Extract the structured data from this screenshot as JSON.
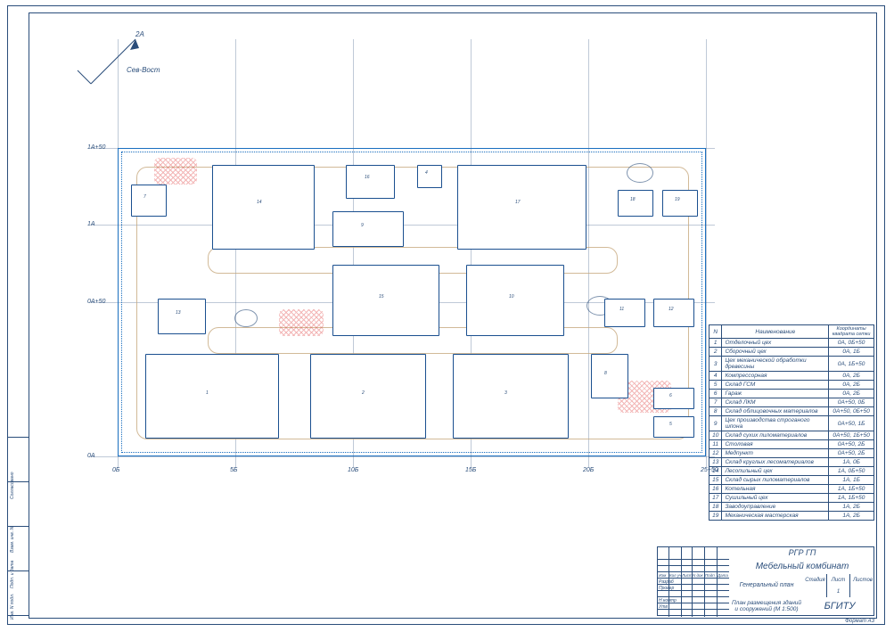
{
  "north": {
    "label": "Сев-Вост",
    "mark": "2А"
  },
  "axes": {
    "vertical": [
      "0Б",
      "5Б",
      "10Б",
      "15Б",
      "20Б",
      "25+50"
    ],
    "horizontal": [
      "1А+50",
      "1А",
      "0А+50",
      "0А"
    ]
  },
  "buildings": [
    {
      "n": 1,
      "name": "Отделочный цех",
      "coord": "0А, 0Б+50"
    },
    {
      "n": 2,
      "name": "Сборочный цех",
      "coord": "0А, 1Б"
    },
    {
      "n": 3,
      "name": "Цех механической обработки древесины",
      "coord": "0А, 1Б+50"
    },
    {
      "n": 4,
      "name": "Компрессорная",
      "coord": "0А, 2Б"
    },
    {
      "n": 5,
      "name": "Склад ГСМ",
      "coord": "0А, 2Б"
    },
    {
      "n": 6,
      "name": "Гараж",
      "coord": "0А, 2Б"
    },
    {
      "n": 7,
      "name": "Склад ЛКМ",
      "coord": "0А+50, 0Б"
    },
    {
      "n": 8,
      "name": "Склад облицовочных материалов",
      "coord": "0А+50, 0Б+50"
    },
    {
      "n": 9,
      "name": "Цех производства строганого шпона",
      "coord": "0А+50, 1Б"
    },
    {
      "n": 10,
      "name": "Склад сухих пиломатериалов",
      "coord": "0А+50, 1Б+50"
    },
    {
      "n": 11,
      "name": "Столовая",
      "coord": "0А+50, 2Б"
    },
    {
      "n": 12,
      "name": "Медпункт",
      "coord": "0А+50, 2Б"
    },
    {
      "n": 13,
      "name": "Склад круглых лесоматериалов",
      "coord": "1А, 0Б"
    },
    {
      "n": 14,
      "name": "Лесопильный цех",
      "coord": "1А, 0Б+50"
    },
    {
      "n": 15,
      "name": "Склад сырых пиломатериалов",
      "coord": "1А, 1Б"
    },
    {
      "n": 16,
      "name": "Котельная",
      "coord": "1А, 1Б+50"
    },
    {
      "n": 17,
      "name": "Сушильный цех",
      "coord": "1А, 1Б+50"
    },
    {
      "n": 18,
      "name": "Заводоуправление",
      "coord": "1А, 2Б"
    },
    {
      "n": 19,
      "name": "Механическая мастерская",
      "coord": "1А, 2Б"
    }
  ],
  "legend_headers": {
    "n": "N",
    "name": "Наименование",
    "coord": "Координаты квадрата сетки"
  },
  "title_block": {
    "code": "РГР ГП",
    "project": "Мебельный комбинат",
    "sheet_type": "Генеральный план",
    "subtitle": "План размещения зданий и сооружений (М 1:500)",
    "org": "БГИТУ",
    "cols": {
      "stage": "Стадия",
      "sheet": "Лист",
      "sheets": "Листов",
      "sheet_val": "1"
    },
    "left_rows": [
      "Изм",
      "Кол уч",
      "Лист",
      "N док",
      "Подп.",
      "Дата"
    ],
    "left_roles": [
      "Разраб",
      "Провер",
      "",
      "Н.контр",
      "Утв"
    ],
    "format": "Формат   А3"
  },
  "margin_labels": [
    "Согласовано",
    "Взам. инв. N",
    "Подп. и дата",
    "Инв. N подл."
  ]
}
